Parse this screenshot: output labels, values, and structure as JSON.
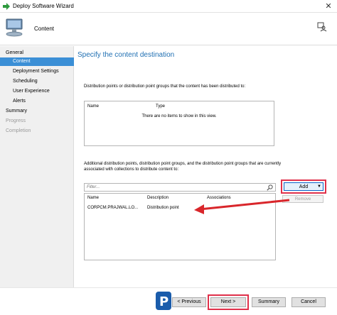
{
  "window": {
    "title": "Deploy Software Wizard",
    "close_glyph": "✕"
  },
  "header": {
    "step_title": "Content"
  },
  "sidebar": {
    "items": [
      {
        "label": "General",
        "level": "top",
        "state": "normal"
      },
      {
        "label": "Content",
        "level": "sub",
        "state": "active"
      },
      {
        "label": "Deployment Settings",
        "level": "sub",
        "state": "normal"
      },
      {
        "label": "Scheduling",
        "level": "sub",
        "state": "normal"
      },
      {
        "label": "User Experience",
        "level": "sub",
        "state": "normal"
      },
      {
        "label": "Alerts",
        "level": "sub",
        "state": "normal"
      },
      {
        "label": "Summary",
        "level": "top",
        "state": "normal"
      },
      {
        "label": "Progress",
        "level": "top",
        "state": "disabled"
      },
      {
        "label": "Completion",
        "level": "top",
        "state": "disabled"
      }
    ]
  },
  "main": {
    "heading": "Specify the content destination",
    "distributed_label": "Distribution points or distribution point groups that the content has been distributed to:",
    "distributed_table": {
      "columns": [
        "Name",
        "Type"
      ],
      "empty_text": "There are no items to show in this view."
    },
    "additional_label": "Additional distribution points, distribution point groups, and the distribution point groups that are currently associated with collections to distribute content to:",
    "filter_placeholder": "Filter...",
    "target_table": {
      "columns": [
        "Name",
        "Description",
        "Associations"
      ],
      "rows": [
        {
          "name": "CORPCM.PRAJWAL.LO...",
          "description": "Distribution point",
          "associations": ""
        }
      ]
    },
    "add_button": {
      "label": "Add",
      "dropdown_glyph": "▼"
    },
    "remove_button": {
      "label": "Remove"
    }
  },
  "footer": {
    "previous_label": "< Previous",
    "next_label": "Next >",
    "summary_label": "Summary",
    "cancel_label": "Cancel"
  },
  "colors": {
    "accent": "#3b8fd6",
    "heading": "#1f6fb2",
    "highlight_red": "#e0304a",
    "arrow_red": "#d9262b"
  }
}
